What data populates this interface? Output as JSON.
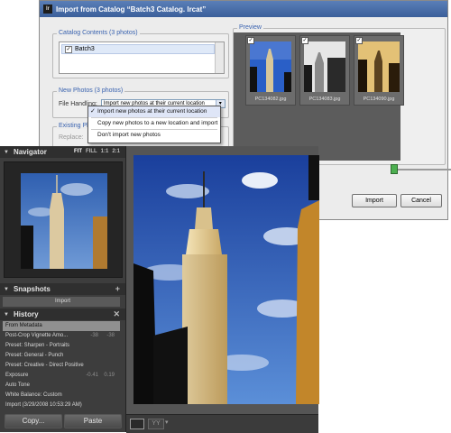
{
  "dialog": {
    "title": "Import from Catalog “Batch3 Catalog. lrcat”",
    "catalog_contents": {
      "title": "Catalog Contents (3 photos)",
      "items": [
        {
          "label": "Batch3",
          "checked": true
        }
      ]
    },
    "new_photos": {
      "title": "New Photos (3 photos)",
      "file_handling_label": "File Handling:",
      "file_handling_value": "Import new photos at their current location",
      "options": [
        "Import new photos at their current location",
        "Copy new photos to a new location and import",
        "Don't import new photos"
      ],
      "selected_option": 0
    },
    "existing_photos": {
      "title": "Existing Photo",
      "replace_label": "Replace:"
    },
    "preview": {
      "title": "Preview",
      "thumbnails": [
        {
          "filename": "PC134082.jpg",
          "checked": true
        },
        {
          "filename": "PC134083.jpg",
          "checked": true
        },
        {
          "filename": "PC134090.jpg",
          "checked": true
        }
      ]
    },
    "buttons": {
      "import": "Import",
      "cancel": "Cancel"
    },
    "titlebar_icon": "lr"
  },
  "navigator": {
    "title": "Navigator",
    "zoom_options": [
      "FIT",
      "FILL",
      "1:1",
      "2:1"
    ],
    "zoom_selected": "FIT"
  },
  "snapshots": {
    "title": "Snapshots",
    "items": [
      "Import"
    ]
  },
  "history": {
    "title": "History",
    "items": [
      {
        "label": "From Metadata",
        "v1": "",
        "v2": "",
        "selected": true
      },
      {
        "label": "Post-Crop Vignette Amo...",
        "v1": "-38",
        "v2": "-38",
        "selected": false
      },
      {
        "label": "Preset: Sharpen - Portraits",
        "v1": "",
        "v2": "",
        "selected": false
      },
      {
        "label": "Preset: General - Punch",
        "v1": "",
        "v2": "",
        "selected": false
      },
      {
        "label": "Preset: Creative - Direct Positive",
        "v1": "",
        "v2": "",
        "selected": false
      },
      {
        "label": "Exposure",
        "v1": "-0.41",
        "v2": "0.19",
        "selected": false
      },
      {
        "label": "Auto Tone",
        "v1": "",
        "v2": "",
        "selected": false
      },
      {
        "label": "White Balance: Custom",
        "v1": "",
        "v2": "",
        "selected": false
      },
      {
        "label": "Import (3/29/2008 10:53:29 AM)",
        "v1": "",
        "v2": "",
        "selected": false
      }
    ]
  },
  "buttons": {
    "copy": "Copy...",
    "paste": "Paste"
  },
  "colors": {
    "dialog_bg": "#ececec",
    "panel_bg": "#3d3d3d",
    "accent_blue": "#3a63b0",
    "slider_green": "#4caf50"
  }
}
